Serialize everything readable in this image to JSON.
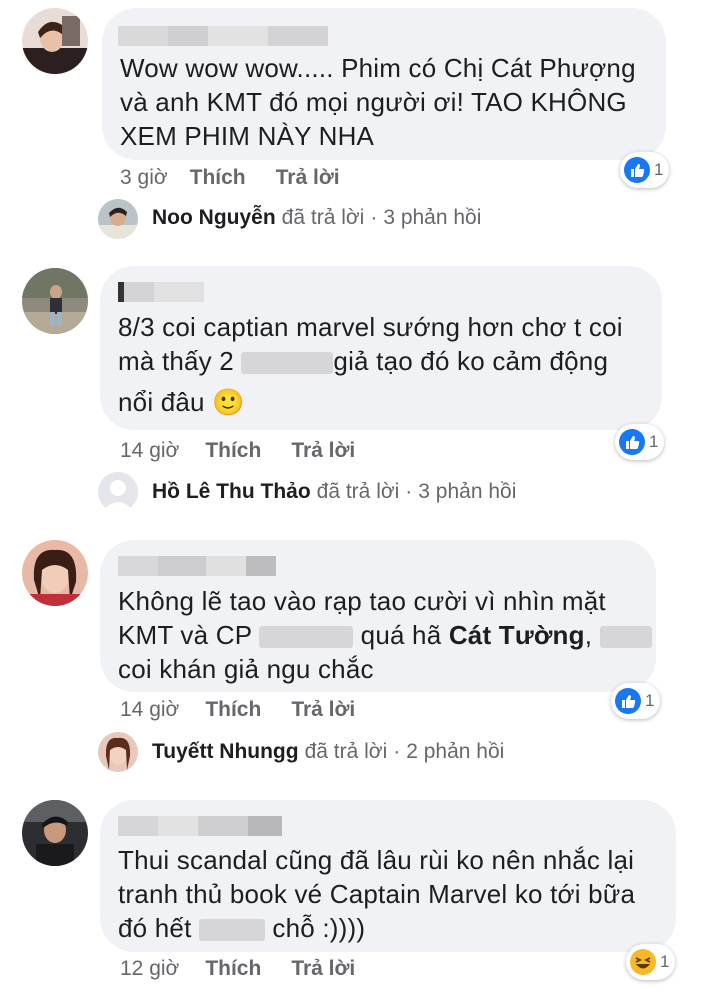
{
  "comments": [
    {
      "text_lines": [
        "Wow wow wow..... Phim có Chị Cát Phượng",
        "và anh KMT đó mọi người ơi! TAO KHÔNG",
        "XEM PHIM NÀY NHA"
      ],
      "time": "3 giờ",
      "like_label": "Thích",
      "reply_label": "Trả lời",
      "reaction": {
        "icon": "like-icon",
        "count": "1"
      },
      "replies": {
        "name": "Noo Nguyễn",
        "verb": "đã trả lời",
        "separator": "·",
        "count_text": "3 phản hồi"
      }
    },
    {
      "line1": "8/3 coi captian marvel sướng hơn chơ t coi",
      "line2_a": "mà thấy 2",
      "line2_b": "giả tạo đó ko cảm động",
      "line3": "nổi đâu",
      "emoji": "🙂",
      "time": "14 giờ",
      "like_label": "Thích",
      "reply_label": "Trả lời",
      "reaction": {
        "icon": "like-icon",
        "count": "1"
      },
      "replies": {
        "name": "Hồ Lê Thu Thảo",
        "verb": "đã trả lời",
        "separator": "·",
        "count_text": "3 phản hồi"
      }
    },
    {
      "line1": "Không lẽ tao vào rạp tao cười vì nhìn mặt",
      "line2_a": "KMT và CP",
      "line2_b": "quá hã",
      "line2_bold": "Cát Tường",
      "line2_c": ",",
      "line3": "coi khán giả ngu chắc",
      "time": "14 giờ",
      "like_label": "Thích",
      "reply_label": "Trả lời",
      "reaction": {
        "icon": "like-icon",
        "count": "1"
      },
      "replies": {
        "name": "Tuyếtt Nhungg",
        "verb": "đã trả lời",
        "separator": "·",
        "count_text": "2 phản hồi"
      }
    },
    {
      "line1": "Thui scandal cũng đã lâu rùi ko nên nhắc lại",
      "line2": "tranh thủ book vé Captain Marvel ko tới bữa",
      "line3_a": "đó hết",
      "line3_b": "chỗ :))))",
      "time": "12 giờ",
      "like_label": "Thích",
      "reply_label": "Trả lời",
      "reaction": {
        "icon": "haha-icon",
        "count": "1"
      }
    }
  ],
  "colors": {
    "like_blue": "#1877f2",
    "bubble": "#f0f2f5",
    "meta_gray": "#65676b",
    "haha_yellow": "#f7b928"
  }
}
